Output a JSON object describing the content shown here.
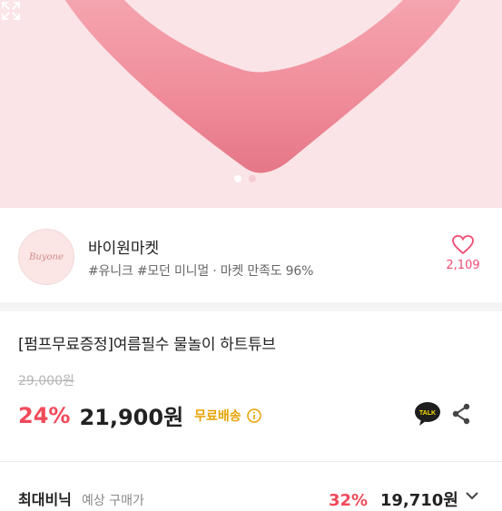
{
  "hero": {
    "active_slide": 1,
    "total_slides": 2
  },
  "shop": {
    "avatar_text": "Buyone",
    "name": "바이원마켓",
    "tags": "#유니크 #모던 미니멀 · 마켓 만족도 96%",
    "like_count": "2,109"
  },
  "product": {
    "title": "[펌프무료증정]여름필수 물놀이 하트튜브",
    "original_price": "29,000원",
    "discount": "24%",
    "price": "21,900원",
    "shipping": "무료배송",
    "talk_label": "TALK"
  },
  "bottom": {
    "label": "최대비닉",
    "sub": "예상 구매가",
    "discount": "32%",
    "price": "19,710원"
  },
  "colors": {
    "accent_pink": "#f04b72",
    "discount_red": "#f04b5b",
    "shipping_yellow": "#e6a300",
    "hero_bg": "#fbe4e7"
  },
  "icons": [
    "heart-icon",
    "info-icon",
    "kakao-talk-icon",
    "share-icon",
    "expand-icon",
    "chevron-down-icon"
  ]
}
